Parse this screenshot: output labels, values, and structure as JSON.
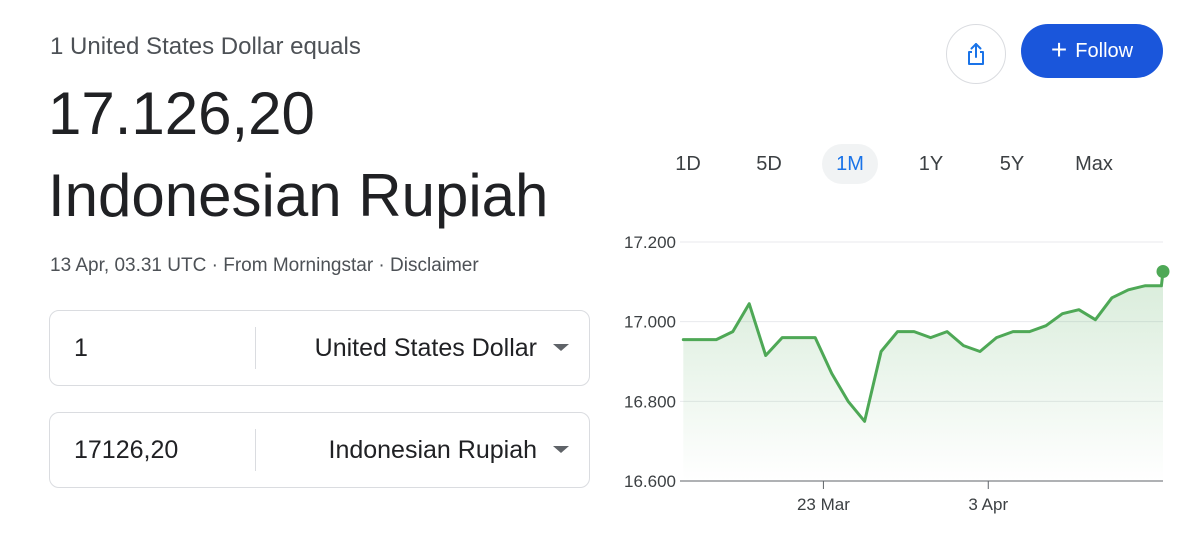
{
  "header": {
    "subtitle": "1 United States Dollar equals",
    "rate": "17.126,20",
    "target_currency": "Indonesian Rupiah"
  },
  "meta": {
    "timestamp": "13 Apr, 03.31 UTC",
    "sep1": " · ",
    "source": "From Morningstar",
    "sep2": " · ",
    "disclaimer": "Disclaimer"
  },
  "converter": {
    "from": {
      "value": "1",
      "currency": "United States Dollar"
    },
    "to": {
      "value": "17126,20",
      "currency": "Indonesian Rupiah"
    }
  },
  "actions": {
    "share_icon": "share-icon",
    "follow_label": "Follow",
    "follow_icon": "+",
    "accent": "#1a56db"
  },
  "ranges": [
    {
      "label": "1D",
      "active": false
    },
    {
      "label": "5D",
      "active": false
    },
    {
      "label": "1M",
      "active": true
    },
    {
      "label": "1Y",
      "active": false
    },
    {
      "label": "5Y",
      "active": false
    },
    {
      "label": "Max",
      "active": false
    }
  ],
  "chart_data": {
    "type": "area",
    "color": "#4ea856",
    "y_ticks": [
      {
        "value": 17200,
        "label": "17.200"
      },
      {
        "value": 17000,
        "label": "17.000"
      },
      {
        "value": 16800,
        "label": "16.800"
      },
      {
        "value": 16600,
        "label": "16.600"
      }
    ],
    "ylim": [
      16600,
      17200
    ],
    "x_ticks": [
      {
        "x": 8.5,
        "label": "23 Mar"
      },
      {
        "x": 18.5,
        "label": "3 Apr"
      }
    ],
    "xlim": [
      -0.2,
      29.1
    ],
    "x": [
      0,
      1,
      2,
      3,
      4,
      5,
      6,
      7,
      8,
      9,
      10,
      11,
      12,
      13,
      14,
      15,
      16,
      17,
      18,
      19,
      20,
      21,
      22,
      23,
      24,
      25,
      26,
      27,
      28,
      29
    ],
    "values": [
      16955,
      16955,
      16955,
      16975,
      17045,
      16915,
      16960,
      16960,
      16960,
      16870,
      16800,
      16750,
      16925,
      16975,
      16975,
      16960,
      16975,
      16940,
      16925,
      16960,
      16975,
      16975,
      16990,
      17020,
      17030,
      17005,
      17060,
      17080,
      17090,
      17090
    ],
    "last_point": {
      "x": 29.1,
      "value": 17126
    }
  }
}
